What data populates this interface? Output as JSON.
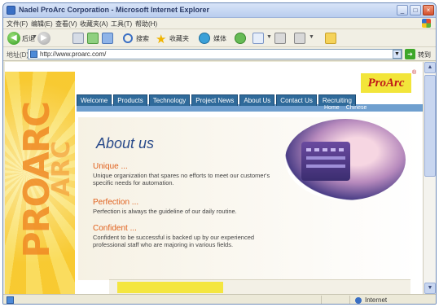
{
  "window": {
    "title": "Nadel ProArc Corporation - Microsoft Internet Explorer"
  },
  "menubar": {
    "items": [
      "文件(F)",
      "编辑(E)",
      "查看(V)",
      "收藏夹(A)",
      "工具(T)",
      "帮助(H)"
    ]
  },
  "toolbar": {
    "back_label": "后退",
    "search_label": "搜索",
    "favorites_label": "收藏夹",
    "media_label": "媒体"
  },
  "address": {
    "label": "地址(D)",
    "url": "http://www.proarc.com/",
    "go_label": "转到"
  },
  "page": {
    "logo_text": "ProArc",
    "logo_mark": "®",
    "sidebar_word_1": "PROARC",
    "sidebar_word_2": "ARC",
    "nav_tabs": [
      "Welcome",
      "Products",
      "Technology",
      "Project News",
      "About Us",
      "Contact Us",
      "Recruiting"
    ],
    "sub_links": [
      "Home",
      "Chinese"
    ],
    "about_title": "About us",
    "sections": [
      {
        "heading": "Unique ...",
        "body": "Unique organization that spares no efforts to meet our customer's specific needs for automation."
      },
      {
        "heading": "Perfection ...",
        "body": "Perfection is always the guideline of our daily routine."
      },
      {
        "heading": "Confident ...",
        "body": "Confident to be successful is backed up by our experienced professional staff who are majoring in various fields."
      }
    ]
  },
  "status": {
    "zone_label": "Internet"
  },
  "colors": {
    "nav_tab": "#2f6a9a",
    "nav_bar": "#6f9fcf",
    "logo_bg": "#f2e53a",
    "logo_text": "#c01818",
    "section_heading": "#e0601c",
    "about_title": "#2a4b8a"
  }
}
